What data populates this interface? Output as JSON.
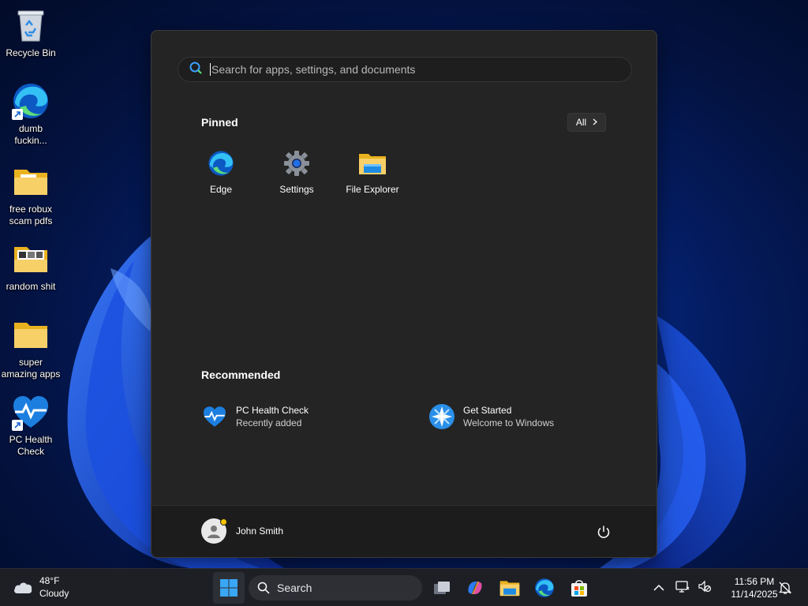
{
  "desktop": {
    "icons": [
      {
        "label": "Recycle Bin"
      },
      {
        "label": "dumb\nfuckin..."
      },
      {
        "label": "free robux\nscam pdfs"
      },
      {
        "label": "random shit"
      },
      {
        "label": "super\namazing apps"
      },
      {
        "label": "PC Health\nCheck"
      }
    ]
  },
  "start_menu": {
    "search": {
      "placeholder": "Search for apps, settings, and documents",
      "value": ""
    },
    "pinned": {
      "title": "Pinned",
      "all_label": "All",
      "apps": [
        {
          "name": "Edge",
          "icon": "edge-icon"
        },
        {
          "name": "Settings",
          "icon": "gear-icon"
        },
        {
          "name": "File Explorer",
          "icon": "folder-icon"
        }
      ]
    },
    "recommended": {
      "title": "Recommended",
      "items": [
        {
          "title": "PC Health Check",
          "subtitle": "Recently added",
          "icon": "health-heart-icon"
        },
        {
          "title": "Get Started",
          "subtitle": "Welcome to Windows",
          "icon": "get-started-icon"
        }
      ]
    },
    "footer": {
      "user_name": "John Smith",
      "power_icon": "power-icon"
    }
  },
  "taskbar": {
    "weather": {
      "temp": "48°F",
      "condition": "Cloudy"
    },
    "search_label": "Search",
    "clock": {
      "time": "11:56 PM",
      "date": "11/14/2025"
    }
  },
  "colors": {
    "start_bg": "#242424",
    "taskbar_bg": "#1d1f24",
    "accent_blue": "#0078d4",
    "folder_yellow": "#f8c93b"
  }
}
